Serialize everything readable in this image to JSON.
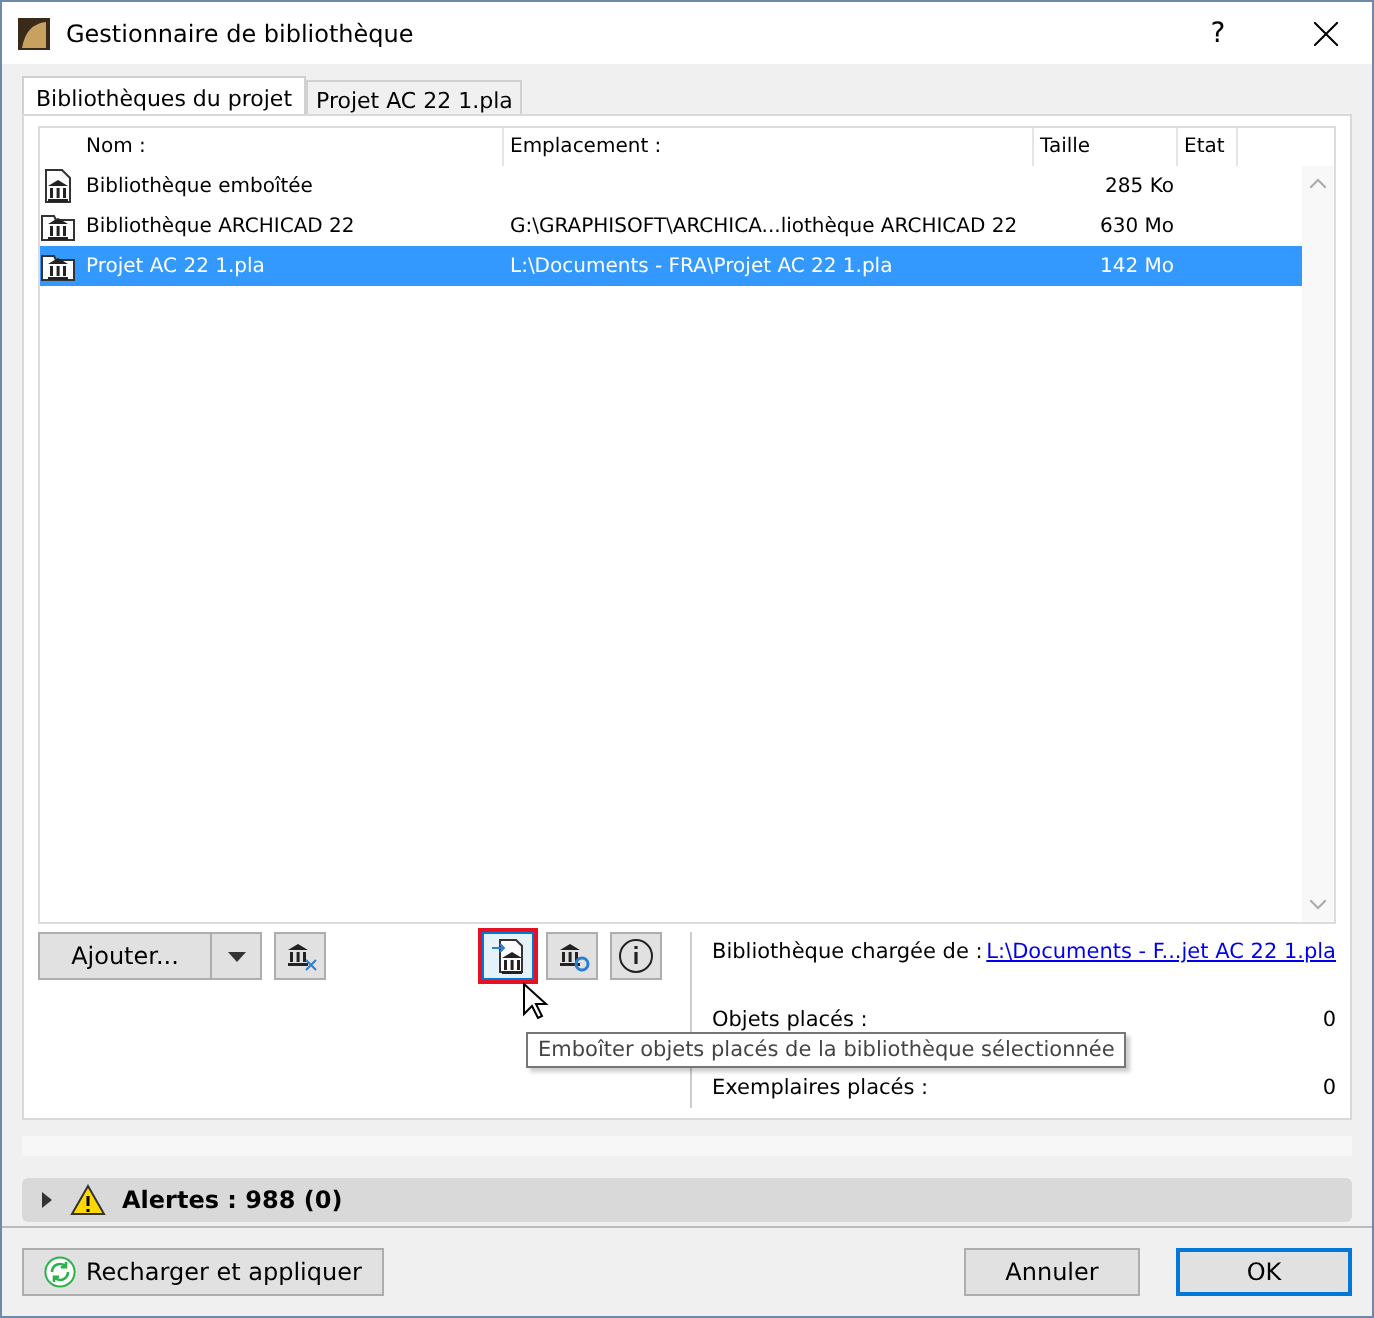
{
  "window": {
    "title": "Gestionnaire de bibliothèque",
    "help": "?"
  },
  "tabs": [
    {
      "label": "Bibliothèques du projet",
      "selected": true
    },
    {
      "label": "Projet AC 22 1.pla",
      "selected": false
    }
  ],
  "table": {
    "columns": [
      "Nom :",
      "Emplacement :",
      "Taille",
      "Etat"
    ],
    "rows": [
      {
        "kind": "file",
        "name": "Bibliothèque emboîtée",
        "location": "",
        "size": "285 Ko",
        "selected": false
      },
      {
        "kind": "folder",
        "name": "Bibliothèque ARCHICAD 22",
        "location": "G:\\GRAPHISOFT\\ARCHICA...liothèque ARCHICAD 22",
        "size": "630 Mo",
        "selected": false
      },
      {
        "kind": "folder",
        "name": "Projet AC 22 1.pla",
        "location": "L:\\Documents - FRA\\Projet AC 22 1.pla",
        "size": "142 Mo",
        "selected": true
      }
    ]
  },
  "add_button": "Ajouter...",
  "details": {
    "loaded_from_label": "Bibliothèque chargée de :",
    "loaded_from_link": "L:\\Documents - F...jet AC 22 1.pla",
    "stats": [
      {
        "label": "Objets placés :",
        "value": "0"
      },
      {
        "label": "Exemplaires placés :",
        "value": "0"
      }
    ]
  },
  "tooltip": "Emboîter objets placés de la bibliothèque sélectionnée",
  "alerts": {
    "label": "Alertes : 988 (0)",
    "expanded": false
  },
  "buttons": [
    {
      "label": "Annuler",
      "default": false
    },
    {
      "label": "OK",
      "default": true
    }
  ],
  "reload_button": "Recharger et appliquer"
}
